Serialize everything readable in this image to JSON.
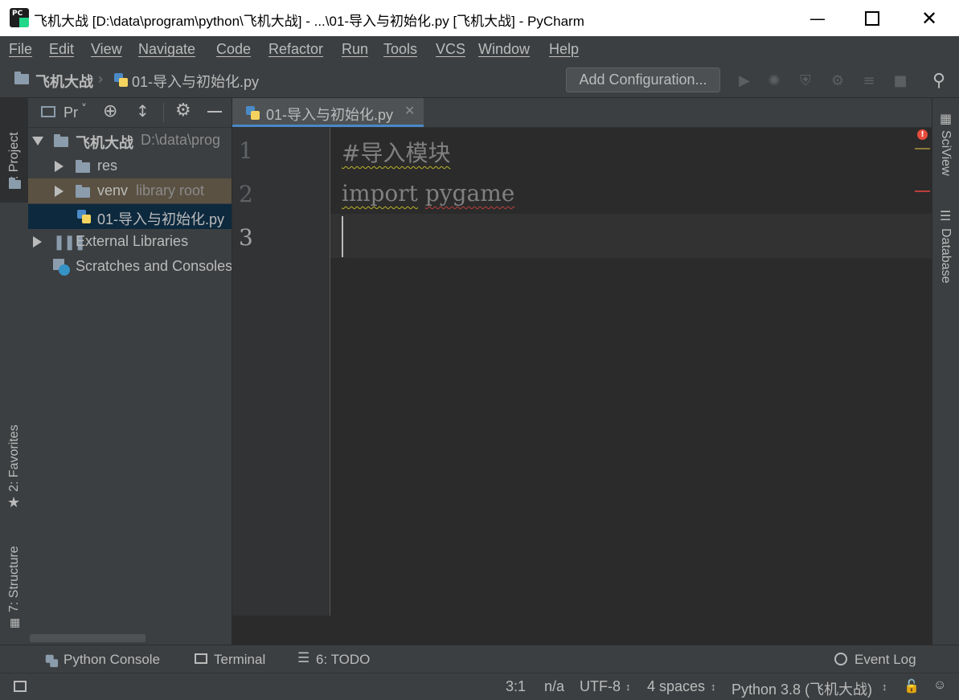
{
  "window": {
    "title": "飞机大战 [D:\\data\\program\\python\\飞机大战] - ...\\01-导入与初始化.py [飞机大战] - PyCharm",
    "app_icon_text": "PC"
  },
  "menu": [
    "File",
    "Edit",
    "View",
    "Navigate",
    "Code",
    "Refactor",
    "Run",
    "Tools",
    "VCS",
    "Window",
    "Help"
  ],
  "navbar": {
    "breadcrumb": [
      "飞机大战",
      "01-导入与初始化.py"
    ],
    "add_configuration": "Add Configuration..."
  },
  "left_tabs": {
    "project": "1: Project",
    "favorites": "2: Favorites",
    "structure": "7: Structure"
  },
  "right_tabs": {
    "sciview": "SciView",
    "database": "Database"
  },
  "project_panel": {
    "title": "Pr",
    "root": {
      "name": "飞机大战",
      "path": "D:\\data\\prog"
    },
    "items": [
      {
        "name": "res",
        "suffix": ""
      },
      {
        "name": "venv",
        "suffix": "library root"
      },
      {
        "name": "01-导入与初始化.py",
        "suffix": ""
      },
      {
        "name": "External Libraries",
        "suffix": ""
      },
      {
        "name": "Scratches and Consoles",
        "suffix": ""
      }
    ]
  },
  "editor": {
    "tab_label": "01-导入与初始化.py",
    "lines": [
      {
        "no": "1",
        "text": "#导入模块"
      },
      {
        "no": "2",
        "text_a": "import",
        "text_b": "pygame"
      },
      {
        "no": "3",
        "text": ""
      }
    ]
  },
  "bottom_tools": {
    "python_console": "Python Console",
    "terminal": "Terminal",
    "todo": "6: TODO",
    "event_log": "Event Log"
  },
  "status": {
    "position": "3:1",
    "na": "n/a",
    "encoding": "UTF-8",
    "indent": "4 spaces",
    "interpreter": "Python 3.8 (飞机大战)"
  }
}
